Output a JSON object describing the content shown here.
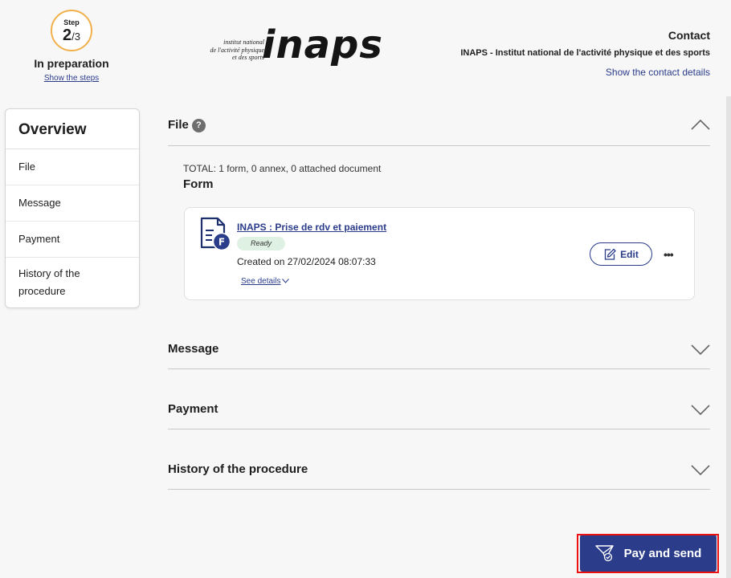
{
  "step": {
    "label": "Step",
    "current": "2",
    "total": "/3",
    "status": "In preparation",
    "show_steps": "Show the steps"
  },
  "logo": {
    "small_lines": [
      "institut national",
      "de l'activité physique",
      "et des sports"
    ],
    "big": "inaps"
  },
  "contact": {
    "title": "Contact",
    "org": "INAPS - Institut national de l'activité physique et des sports",
    "link": "Show the contact details"
  },
  "sidebar": {
    "heading": "Overview",
    "items": [
      {
        "label": "File"
      },
      {
        "label": "Message"
      },
      {
        "label": "Payment"
      },
      {
        "label": "History of the procedure"
      }
    ]
  },
  "file_section": {
    "title": "File",
    "help": "?",
    "total": "TOTAL: 1 form, 0 annex, 0 attached document",
    "form_heading": "Form",
    "card": {
      "icon_letter": "F",
      "link": "INAPS : Prise de rdv et paiement",
      "badge": "Ready",
      "created": "Created on 27/02/2024 08:07:33",
      "see_details": "See details",
      "edit": "Edit",
      "more": "•••"
    }
  },
  "sections": [
    {
      "title": "Message"
    },
    {
      "title": "Payment"
    },
    {
      "title": "History of the procedure"
    }
  ],
  "actions": {
    "pay_send": "Pay and send"
  },
  "colors": {
    "accent": "#2a3c8a",
    "step_ring": "#f2b04a",
    "badge_bg": "#dff1e2",
    "highlight": "#ee1111"
  }
}
